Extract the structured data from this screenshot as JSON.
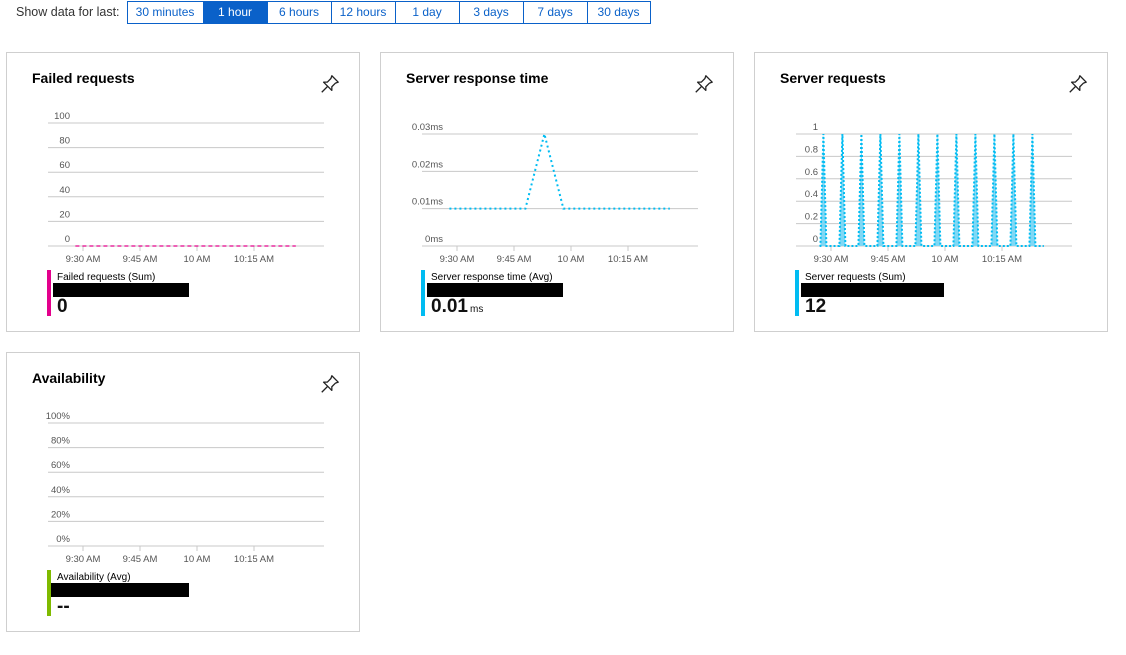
{
  "timebar": {
    "label": "Show data for last:",
    "options": [
      "30 minutes",
      "1 hour",
      "6 hours",
      "12 hours",
      "1 day",
      "3 days",
      "7 days",
      "30 days"
    ],
    "selected": "1 hour"
  },
  "colors": {
    "accent": "#0a61c9",
    "failed": "#e3008c",
    "response": "#00bcf2",
    "requests": "#00bcf2",
    "availability": "#7fba00"
  },
  "cards": [
    {
      "title": "Failed requests",
      "legend_name": "Failed requests (Sum)",
      "value": "0",
      "unit": ""
    },
    {
      "title": "Server response time",
      "legend_name": "Server response time (Avg)",
      "value": "0.01",
      "unit": "ms"
    },
    {
      "title": "Server requests",
      "legend_name": "Server requests (Sum)",
      "value": "12",
      "unit": ""
    },
    {
      "title": "Availability",
      "legend_name": "Availability (Avg)",
      "value": "--",
      "unit": ""
    }
  ],
  "chart_data": [
    {
      "type": "line",
      "title": "Failed requests",
      "xlabel": "",
      "ylabel": "",
      "x_ticks": [
        "9:30 AM",
        "9:45 AM",
        "10 AM",
        "10:15 AM"
      ],
      "y_ticks": [
        "0",
        "20",
        "40",
        "60",
        "80",
        "100"
      ],
      "ylim": [
        0,
        100
      ],
      "xlim_minutes_from_9am": [
        19,
        67
      ],
      "series": [
        {
          "name": "Failed requests (Sum)",
          "color": "#e3008c",
          "style": "dashed",
          "x_minutes_from_9am": [
            28,
            86
          ],
          "values": [
            0,
            0
          ]
        }
      ]
    },
    {
      "type": "line",
      "title": "Server response time",
      "xlabel": "",
      "ylabel": "",
      "x_ticks": [
        "9:30 AM",
        "9:45 AM",
        "10 AM",
        "10:15 AM"
      ],
      "y_ticks": [
        "0ms",
        "0.01ms",
        "0.02ms",
        "0.03ms"
      ],
      "ylim": [
        0,
        0.03
      ],
      "series": [
        {
          "name": "Server response time (Avg)",
          "color": "#00bcf2",
          "style": "dotted",
          "x_minutes_from_9am": [
            28,
            48,
            53,
            58,
            86
          ],
          "values": [
            0.01,
            0.01,
            0.03,
            0.01,
            0.01
          ]
        }
      ]
    },
    {
      "type": "area",
      "title": "Server requests",
      "xlabel": "",
      "ylabel": "",
      "x_ticks": [
        "9:30 AM",
        "9:45 AM",
        "10 AM",
        "10:15 AM"
      ],
      "y_ticks": [
        "0",
        "0.2",
        "0.4",
        "0.6",
        "0.8",
        "1"
      ],
      "ylim": [
        0,
        1
      ],
      "series": [
        {
          "name": "Server requests (Sum)",
          "color": "#00bcf2",
          "style": "dotted-filled",
          "spike_minutes_from_9am": [
            28,
            33,
            38,
            43,
            48,
            53,
            58,
            63,
            68,
            73,
            78,
            83
          ],
          "spike_value": 1,
          "baseline": 0,
          "end_minute": 86
        }
      ]
    },
    {
      "type": "line",
      "title": "Availability",
      "xlabel": "",
      "ylabel": "",
      "x_ticks": [
        "9:30 AM",
        "9:45 AM",
        "10 AM",
        "10:15 AM"
      ],
      "y_ticks": [
        "0%",
        "20%",
        "40%",
        "60%",
        "80%",
        "100%"
      ],
      "ylim": [
        0,
        100
      ],
      "series": []
    }
  ]
}
